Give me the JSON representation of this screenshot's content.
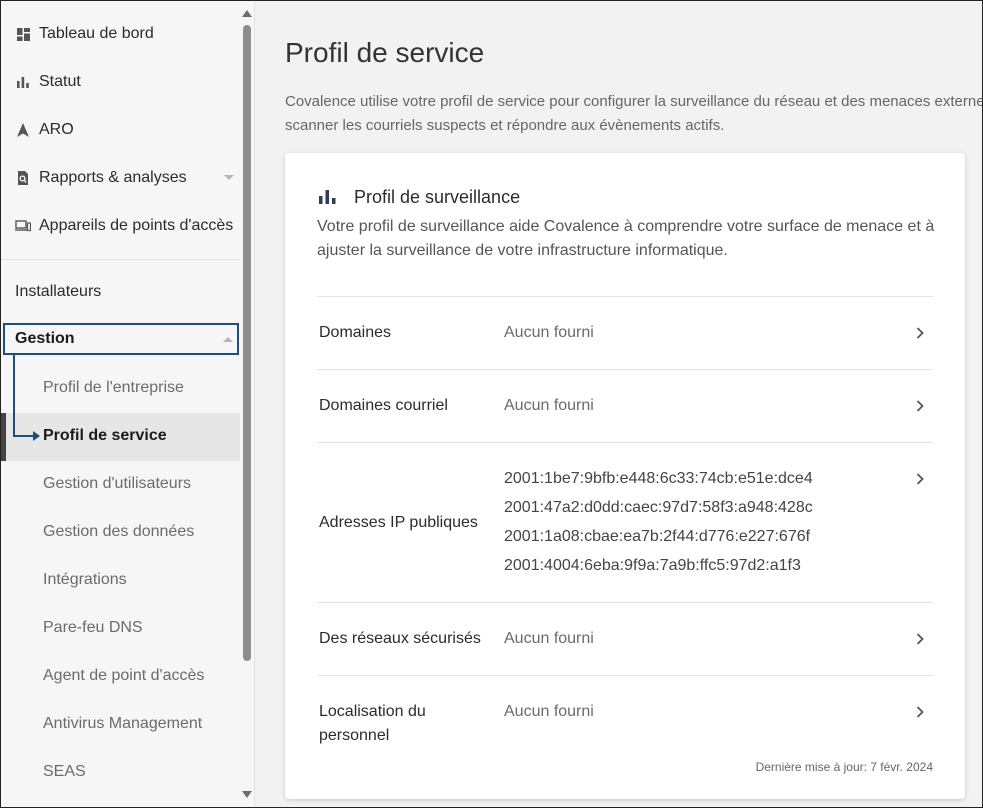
{
  "sidebar": {
    "top_items": [
      {
        "label": "Tableau de bord",
        "icon": "dashboard-icon"
      },
      {
        "label": "Statut",
        "icon": "bar-chart-icon"
      },
      {
        "label": "ARO",
        "icon": "navigation-arrow-icon"
      },
      {
        "label": "Rapports & analyses",
        "icon": "report-search-icon"
      },
      {
        "label": "Appareils de points d'accès",
        "icon": "devices-icon"
      }
    ],
    "installateurs": "Installateurs",
    "gestion": "Gestion",
    "sub_items": [
      "Profil de l'entreprise",
      "Profil de service",
      "Gestion d'utilisateurs",
      "Gestion des données",
      "Intégrations",
      "Pare-feu DNS",
      "Agent de point d'accès",
      "Antivirus Management",
      "SEAS"
    ],
    "active_index": 1
  },
  "main": {
    "title": "Profil de service",
    "description": "Covalence utilise votre profil de service pour configurer la surveillance du réseau et des menaces externes, scanner les courriels suspects et répondre aux évènements actifs.",
    "card": {
      "icon": "bar-chart-icon",
      "title": "Profil de surveillance",
      "description": "Votre profil de surveillance aide Covalence à comprendre votre surface de menace et à ajuster la surveillance de votre infrastructure informatique.",
      "rows": [
        {
          "label": "Domaines",
          "value": "Aucun fourni"
        },
        {
          "label": "Domaines courriel",
          "value": "Aucun fourni"
        },
        {
          "label": "Adresses IP publiques",
          "values": [
            "2001:1be7:9bfb:e448:6c33:74cb:e51e:dce4",
            "2001:47a2:d0dd:caec:97d7:58f3:a948:428c",
            "2001:1a08:cbae:ea7b:2f44:d776:e227:676f",
            "2001:4004:6eba:9f9a:7a9b:ffc5:97d2:a1f3"
          ]
        },
        {
          "label": "Des réseaux sécurisés",
          "value": "Aucun fourni"
        },
        {
          "label": "Localisation du personnel",
          "value": "Aucun fourni"
        }
      ],
      "last_updated": "Dernière mise à jour: 7 févr. 2024"
    }
  },
  "colors": {
    "highlight_border": "#1f4e79",
    "active_bar": "#444444",
    "card_background": "#ffffff"
  }
}
